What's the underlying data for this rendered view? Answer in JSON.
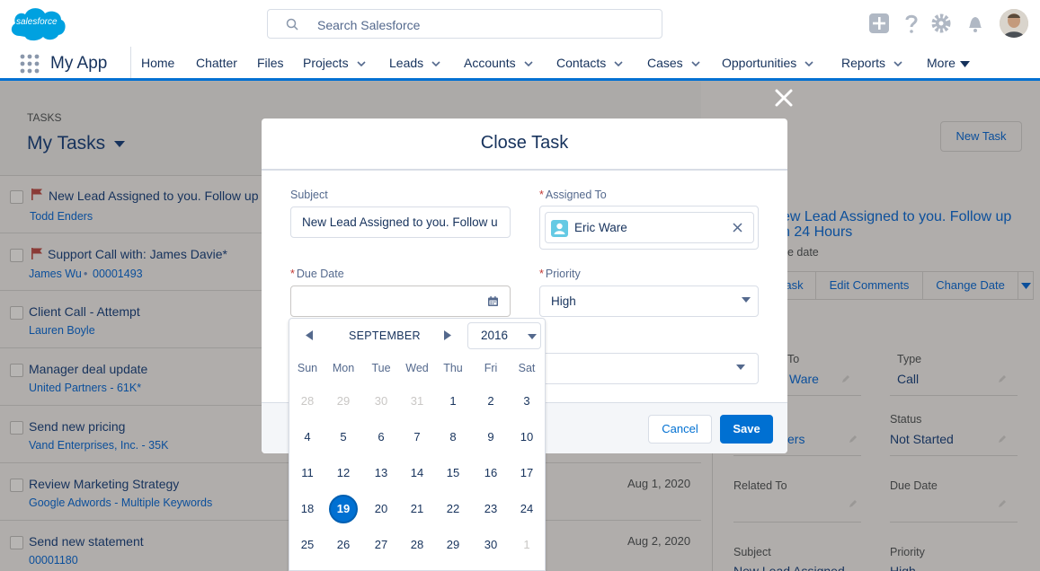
{
  "topbar": {
    "logo_text": "salesforce",
    "search_placeholder": "Search Salesforce",
    "icons": [
      "add-icon",
      "help-icon",
      "setup-gear-icon",
      "notifications-bell-icon"
    ]
  },
  "nav": {
    "app_name": "My App",
    "items": [
      {
        "label": "Home",
        "has_menu": false
      },
      {
        "label": "Chatter",
        "has_menu": false
      },
      {
        "label": "Files",
        "has_menu": false
      },
      {
        "label": "Projects",
        "has_menu": true
      },
      {
        "label": "Leads",
        "has_menu": true
      },
      {
        "label": "Accounts",
        "has_menu": true
      },
      {
        "label": "Contacts",
        "has_menu": true
      },
      {
        "label": "Cases",
        "has_menu": true
      },
      {
        "label": "Opportunities",
        "has_menu": true
      },
      {
        "label": "Reports",
        "has_menu": true
      },
      {
        "label": "More",
        "has_menu": true
      }
    ]
  },
  "list": {
    "section_label": "TASKS",
    "title": "My Tasks",
    "new_task": "New Task",
    "rows": [
      {
        "title": "New Lead Assigned to you. Follow up w",
        "sub": "Todd Enders",
        "sub2": "",
        "date": "",
        "flag": true
      },
      {
        "title": "Support Call with: James Davie*",
        "sub": "James Wu",
        "sub2": "00001493",
        "date": "",
        "flag": true
      },
      {
        "title": "Client Call - Attempt",
        "sub": "Lauren Boyle",
        "sub2": "",
        "date": "",
        "flag": false
      },
      {
        "title": "Manager deal update",
        "sub": "United Partners - 61K*",
        "sub2": "",
        "date": "",
        "flag": false
      },
      {
        "title": "Send new pricing",
        "sub": "Vand Enterprises, Inc. - 35K",
        "sub2": "",
        "date": "",
        "flag": false
      },
      {
        "title": "Review Marketing Strategy",
        "sub": "Google Adwords - Multiple Keywords",
        "sub2": "",
        "date": "Aug 1, 2020",
        "flag": false
      },
      {
        "title": "Send new statement",
        "sub": "00001180",
        "sub2": "",
        "date": "Aug 2, 2020",
        "flag": false
      }
    ]
  },
  "detail": {
    "title_line1": "ew Lead Assigned to you. Follow up",
    "title_line2": "n 24 Hours",
    "due_label": "e date",
    "btn_task": "ask",
    "btn_edit_comments": "Edit Comments",
    "btn_change_date": "Change Date",
    "assigned_label": "To",
    "assigned_value": "Ware",
    "type_label": "Type",
    "type_value": "Call",
    "status_label": "Status",
    "status_value": "Not Started",
    "name_value": "ers",
    "related_label": "Related To",
    "due_date_label": "Due Date",
    "subject_label": "Subject",
    "subject_value": "New Lead Assigned",
    "priority_label": "Priority",
    "priority_value": "High"
  },
  "modal": {
    "title": "Close Task",
    "subject_label": "Subject",
    "subject_value": "New Lead Assigned to you. Follow u",
    "assigned_label": "Assigned To",
    "assigned_value": "Eric Ware",
    "due_label": "Due Date",
    "due_value": "",
    "priority_label": "Priority",
    "priority_value": "High",
    "cancel": "Cancel",
    "save": "Save"
  },
  "datepicker": {
    "month": "SEPTEMBER",
    "year": "2016",
    "weekdays": [
      "Sun",
      "Mon",
      "Tue",
      "Wed",
      "Thu",
      "Fri",
      "Sat"
    ],
    "weeks": [
      [
        {
          "d": "28",
          "dim": true
        },
        {
          "d": "29",
          "dim": true
        },
        {
          "d": "30",
          "dim": true
        },
        {
          "d": "31",
          "dim": true
        },
        {
          "d": "1"
        },
        {
          "d": "2"
        },
        {
          "d": "3"
        }
      ],
      [
        {
          "d": "4"
        },
        {
          "d": "5"
        },
        {
          "d": "6"
        },
        {
          "d": "7"
        },
        {
          "d": "8"
        },
        {
          "d": "9"
        },
        {
          "d": "10"
        }
      ],
      [
        {
          "d": "11"
        },
        {
          "d": "12"
        },
        {
          "d": "13"
        },
        {
          "d": "14"
        },
        {
          "d": "15"
        },
        {
          "d": "16"
        },
        {
          "d": "17"
        }
      ],
      [
        {
          "d": "18"
        },
        {
          "d": "19",
          "selected": true
        },
        {
          "d": "20"
        },
        {
          "d": "21"
        },
        {
          "d": "22"
        },
        {
          "d": "23"
        },
        {
          "d": "24"
        }
      ],
      [
        {
          "d": "25"
        },
        {
          "d": "26"
        },
        {
          "d": "27"
        },
        {
          "d": "28"
        },
        {
          "d": "29"
        },
        {
          "d": "30"
        },
        {
          "d": "1",
          "dim": true
        }
      ]
    ]
  },
  "colors": {
    "brand": "#0070d2",
    "overlay": "#b0adab",
    "text": "#16325c",
    "required": "#c23934"
  }
}
